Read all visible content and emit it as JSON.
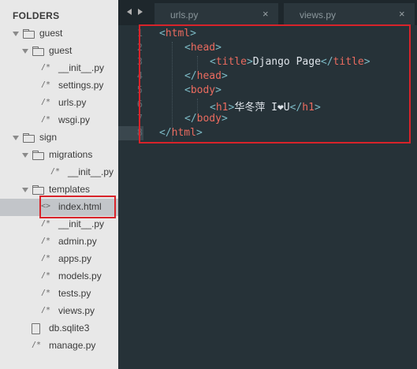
{
  "sidebar": {
    "header": "FOLDERS",
    "items": [
      {
        "label": "guest",
        "type": "folder",
        "expanded": true
      },
      {
        "label": "guest",
        "type": "folder",
        "expanded": true
      },
      {
        "label": "__init__.py",
        "type": "py"
      },
      {
        "label": "settings.py",
        "type": "py"
      },
      {
        "label": "urls.py",
        "type": "py"
      },
      {
        "label": "wsgi.py",
        "type": "py"
      },
      {
        "label": "sign",
        "type": "folder",
        "expanded": true
      },
      {
        "label": "migrations",
        "type": "folder",
        "expanded": true
      },
      {
        "label": "__init__.py",
        "type": "py"
      },
      {
        "label": "templates",
        "type": "folder",
        "expanded": true
      },
      {
        "label": "index.html",
        "type": "html",
        "selected": true
      },
      {
        "label": "__init__.py",
        "type": "py"
      },
      {
        "label": "admin.py",
        "type": "py"
      },
      {
        "label": "apps.py",
        "type": "py"
      },
      {
        "label": "models.py",
        "type": "py"
      },
      {
        "label": "tests.py",
        "type": "py"
      },
      {
        "label": "views.py",
        "type": "py"
      },
      {
        "label": "db.sqlite3",
        "type": "file"
      },
      {
        "label": "manage.py",
        "type": "py"
      }
    ]
  },
  "tabs": [
    {
      "label": "urls.py",
      "close": "×"
    },
    {
      "label": "views.py",
      "close": "×"
    }
  ],
  "editor": {
    "line_numbers": [
      "1",
      "2",
      "3",
      "4",
      "5",
      "6",
      "7",
      "8"
    ],
    "current_line": "8",
    "lines": [
      {
        "parts": [
          [
            "br",
            "<"
          ],
          [
            "tg",
            "html"
          ],
          [
            "br",
            ">"
          ]
        ]
      },
      {
        "parts": [
          [
            "br",
            "<"
          ],
          [
            "tg",
            "head"
          ],
          [
            "br",
            ">"
          ]
        ]
      },
      {
        "parts": [
          [
            "br",
            "<"
          ],
          [
            "tg",
            "title"
          ],
          [
            "br",
            ">"
          ],
          [
            "tx",
            "Django Page"
          ],
          [
            "br",
            "</"
          ],
          [
            "tg",
            "title"
          ],
          [
            "br",
            ">"
          ]
        ]
      },
      {
        "parts": [
          [
            "br",
            "</"
          ],
          [
            "tg",
            "head"
          ],
          [
            "br",
            ">"
          ]
        ]
      },
      {
        "parts": [
          [
            "br",
            "<"
          ],
          [
            "tg",
            "body"
          ],
          [
            "br",
            ">"
          ]
        ]
      },
      {
        "parts": [
          [
            "br",
            "<"
          ],
          [
            "tg",
            "h1"
          ],
          [
            "br",
            ">"
          ],
          [
            "tx",
            "华冬萍 I❤U"
          ],
          [
            "br",
            "</"
          ],
          [
            "tg",
            "h1"
          ],
          [
            "br",
            ">"
          ]
        ]
      },
      {
        "parts": [
          [
            "br",
            "</"
          ],
          [
            "tg",
            "body"
          ],
          [
            "br",
            ">"
          ]
        ]
      },
      {
        "parts": [
          [
            "br",
            "</"
          ],
          [
            "tg",
            "html"
          ],
          [
            "br",
            ">"
          ]
        ]
      }
    ]
  },
  "colors": {
    "highlight_box": "#d8232a",
    "sidebar_bg": "#e8e8e8",
    "editor_bg": "#263238"
  }
}
